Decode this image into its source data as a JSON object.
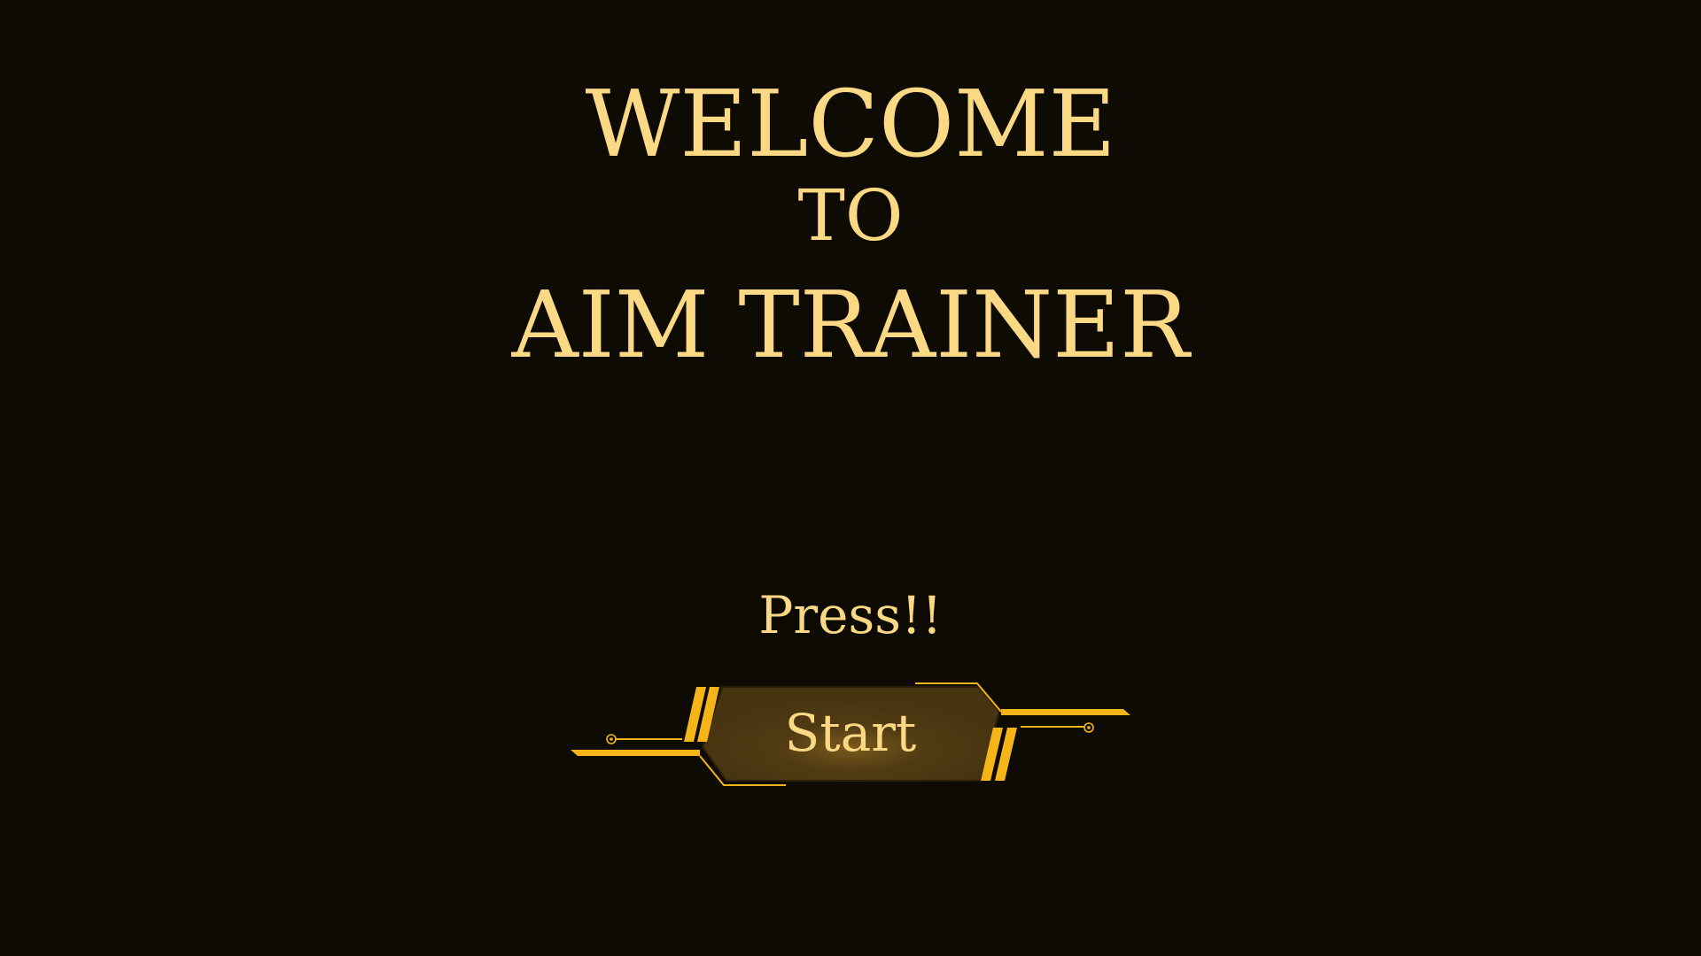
{
  "title": {
    "line1": "WELCOME",
    "line2": "TO",
    "line3": "AIM TRAINER"
  },
  "prompt": {
    "text": "Press!!"
  },
  "start_button": {
    "label": "Start"
  },
  "colors": {
    "background": "#0e0b05",
    "text": "#fbd984",
    "accent": "#f5b417",
    "button_fill": "#4d3812"
  }
}
